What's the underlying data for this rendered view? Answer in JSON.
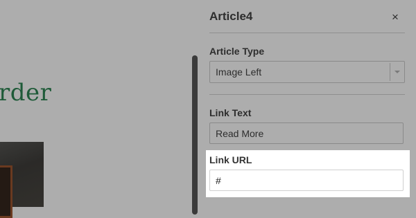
{
  "page": {
    "heading_fragment": "rder"
  },
  "panel": {
    "title": "Article4",
    "close_symbol": "×",
    "article_type": {
      "label": "Article Type",
      "value": "Image Left"
    },
    "link_text": {
      "label": "Link Text",
      "value": "Read More"
    },
    "link_url": {
      "label": "Link URL",
      "value": "#"
    }
  },
  "colors": {
    "overlay": "#adadad",
    "heading_green": "#1e5a38",
    "highlight": "#ffffff"
  },
  "icons": {
    "close": "close-icon",
    "dropdown": "chevron-down-icon"
  }
}
